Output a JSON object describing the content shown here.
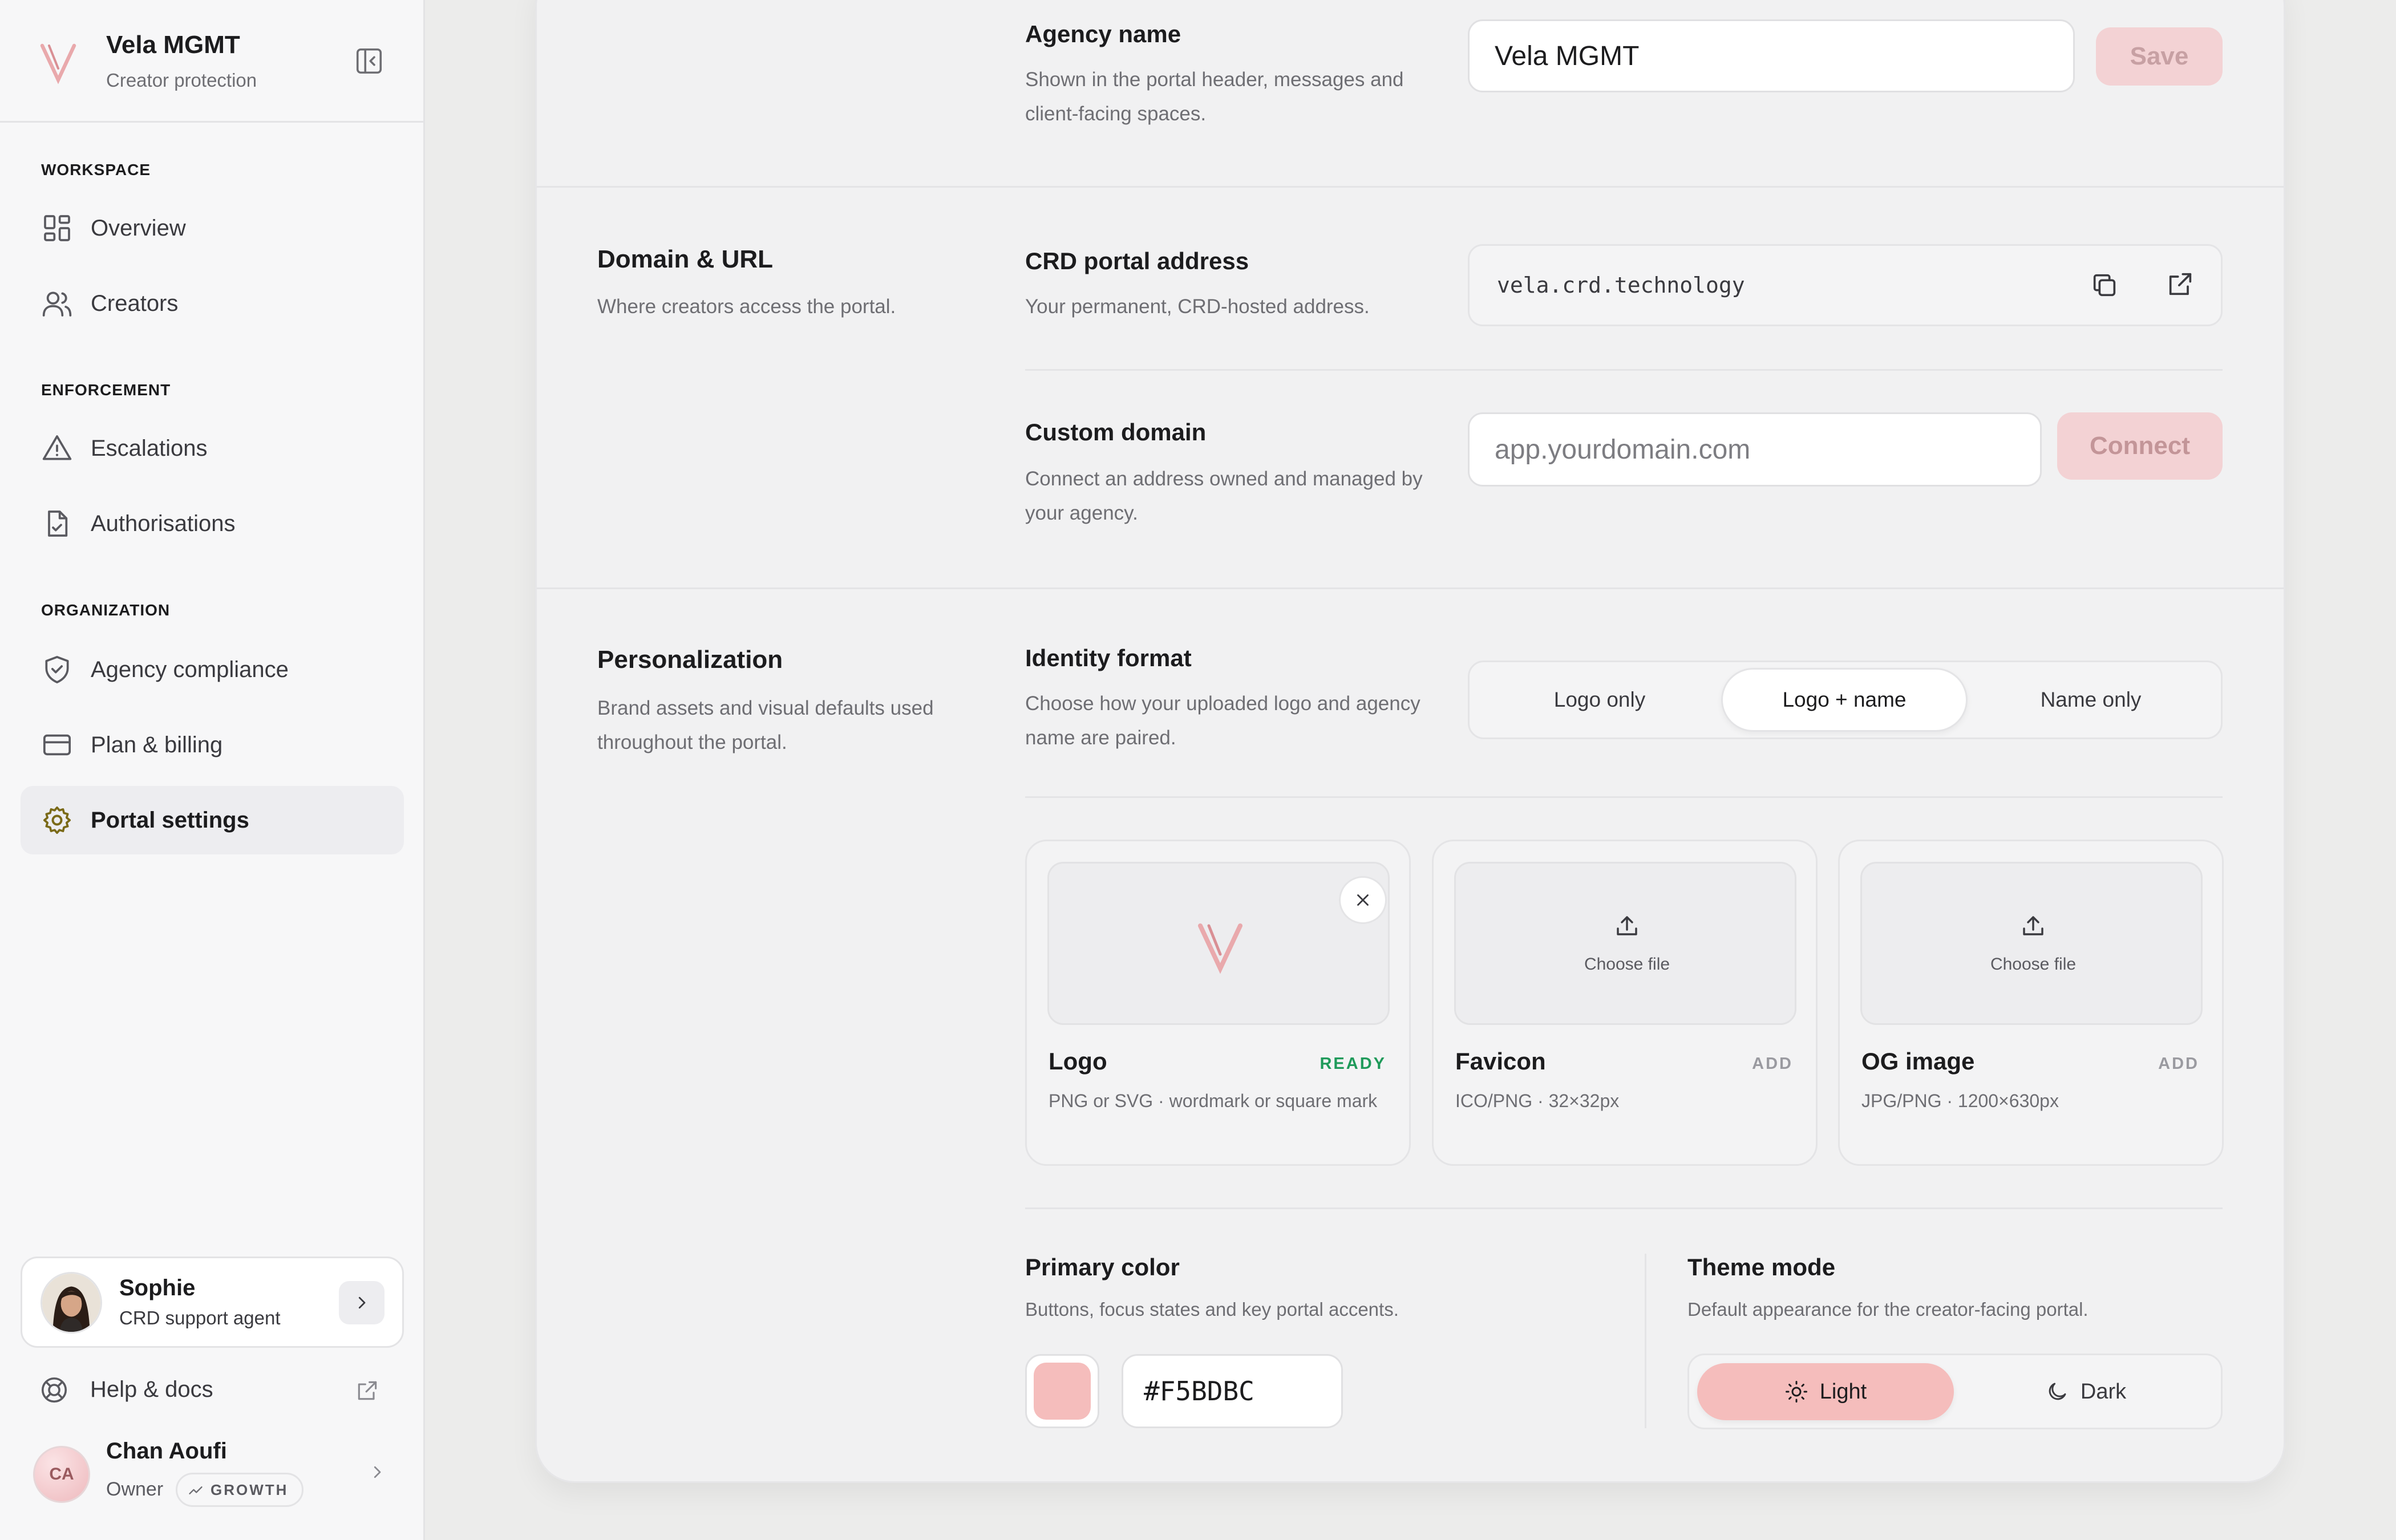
{
  "brand": {
    "name": "Vela MGMT",
    "tagline": "Creator protection",
    "logo_icon": "vela-v-logo",
    "accent_color": "#F5BDBC"
  },
  "sidebar": {
    "sections": [
      {
        "label": "WORKSPACE",
        "items": [
          {
            "label": "Overview",
            "icon": "grid-icon"
          },
          {
            "label": "Creators",
            "icon": "users-icon"
          }
        ]
      },
      {
        "label": "ENFORCEMENT",
        "items": [
          {
            "label": "Escalations",
            "icon": "warning-icon"
          },
          {
            "label": "Authorisations",
            "icon": "document-check-icon"
          }
        ]
      },
      {
        "label": "ORGANIZATION",
        "items": [
          {
            "label": "Agency compliance",
            "icon": "shield-check-icon"
          },
          {
            "label": "Plan & billing",
            "icon": "credit-card-icon"
          },
          {
            "label": "Portal settings",
            "icon": "gear-icon",
            "active": true
          }
        ]
      }
    ],
    "support_agent": {
      "name": "Sophie",
      "role": "CRD support agent"
    },
    "help": {
      "label": "Help & docs"
    },
    "user": {
      "initials": "CA",
      "name": "Chan Aoufi",
      "role": "Owner",
      "plan": "GROWTH"
    }
  },
  "settings": {
    "agency_name": {
      "title": "Agency name",
      "description": "Shown in the portal header, messages and client-facing spaces.",
      "value": "Vela MGMT",
      "save_label": "Save"
    },
    "domain": {
      "section_title": "Domain & URL",
      "section_description": "Where creators access the portal.",
      "portal_address": {
        "title": "CRD portal address",
        "description": "Your permanent, CRD-hosted address.",
        "value": "vela.crd.technology"
      },
      "custom_domain": {
        "title": "Custom domain",
        "description": "Connect an address owned and managed by your agency.",
        "placeholder": "app.yourdomain.com",
        "connect_label": "Connect"
      }
    },
    "personalization": {
      "section_title": "Personalization",
      "section_description": "Brand assets and visual defaults used throughout the portal.",
      "identity_format": {
        "title": "Identity format",
        "description": "Choose how your uploaded logo and agency name are paired.",
        "options": [
          "Logo only",
          "Logo + name",
          "Name only"
        ],
        "selected": "Logo + name"
      },
      "assets": [
        {
          "title": "Logo",
          "status": "READY",
          "description": "PNG or SVG · wordmark or square mark"
        },
        {
          "title": "Favicon",
          "status": "ADD",
          "description": "ICO/PNG · 32×32px",
          "choose_label": "Choose file"
        },
        {
          "title": "OG image",
          "status": "ADD",
          "description": "JPG/PNG · 1200×630px",
          "choose_label": "Choose file"
        }
      ],
      "primary_color": {
        "title": "Primary color",
        "description": "Buttons, focus states and key portal accents.",
        "value": "#F5BDBC"
      },
      "theme_mode": {
        "title": "Theme mode",
        "description": "Default appearance for the creator-facing portal.",
        "options": [
          "Light",
          "Dark"
        ],
        "selected": "Light"
      }
    }
  },
  "status_colors": {
    "ready": "#1f9a5a",
    "add": "#9a9aa0"
  }
}
